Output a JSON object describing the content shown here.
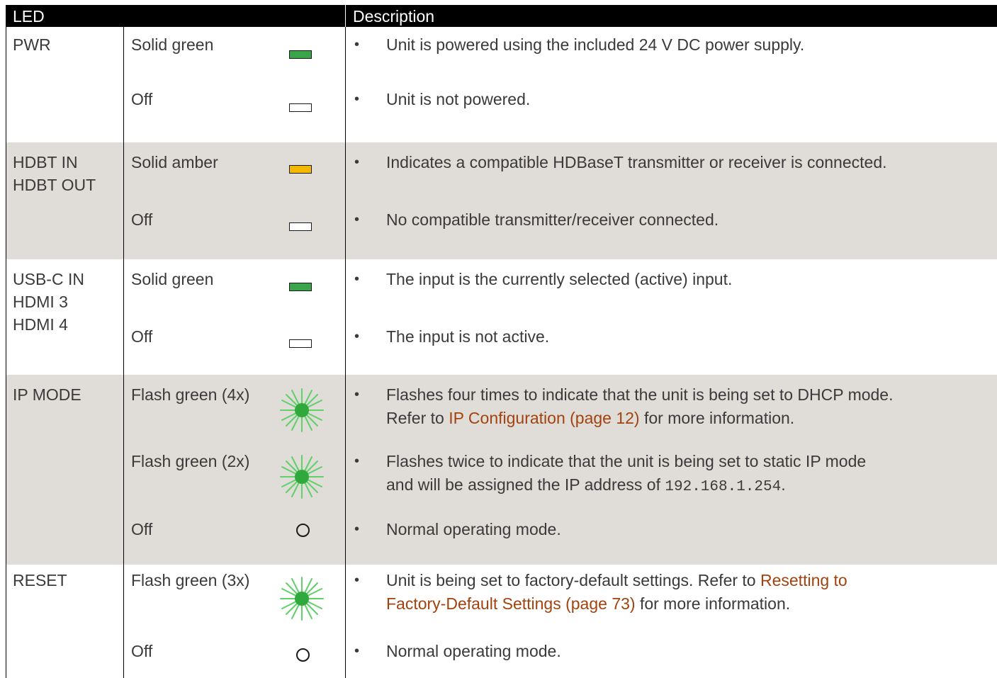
{
  "header": {
    "led": "LED",
    "description": "Description"
  },
  "colors": {
    "green": "#3aa54a",
    "amber": "#f5b800",
    "link": "#a2430f",
    "shade": "#e0dcd8"
  },
  "groups": [
    {
      "leds": [
        "PWR"
      ],
      "rows": [
        {
          "state": "Solid green",
          "icon": "led-solid-green-icon",
          "desc": [
            "Unit is powered using the included 24 V DC power supply."
          ]
        },
        {
          "state": "Off",
          "icon": "led-off-icon",
          "desc": [
            "Unit is not powered."
          ]
        }
      ]
    },
    {
      "leds": [
        "HDBT IN",
        "HDBT OUT"
      ],
      "rows": [
        {
          "state": "Solid amber",
          "icon": "led-solid-amber-icon",
          "desc": [
            "Indicates a compatible HDBaseT transmitter or receiver is connected."
          ]
        },
        {
          "state": "Off",
          "icon": "led-off-icon",
          "desc": [
            "No compatible transmitter/receiver connected."
          ]
        }
      ]
    },
    {
      "leds": [
        "USB-C IN",
        "HDMI 3",
        "HDMI 4"
      ],
      "rows": [
        {
          "state": "Solid green",
          "icon": "led-solid-green-icon",
          "desc": [
            "The input is the currently selected (active) input."
          ]
        },
        {
          "state": "Off",
          "icon": "led-off-icon",
          "desc": [
            "The input is not active."
          ]
        }
      ]
    },
    {
      "leds": [
        "IP MODE"
      ],
      "rows": [
        {
          "state": "Flash green (4x)",
          "icon": "led-flash-green-icon",
          "desc": [
            "Flashes four times to indicate that the unit is being set to DHCP mode.",
            "Refer to ",
            "IP Configuration (page 12)",
            " for more information."
          ]
        },
        {
          "state": "Flash green (2x)",
          "icon": "led-flash-green-icon",
          "desc": [
            "Flashes twice to indicate that the unit is being set to static IP mode",
            "and will be assigned the IP address of ",
            "192.168.1.254",
            "."
          ]
        },
        {
          "state": "Off",
          "icon": "led-off-circle-icon",
          "desc": [
            "Normal operating mode."
          ]
        }
      ]
    },
    {
      "leds": [
        "RESET"
      ],
      "rows": [
        {
          "state": "Flash green (3x)",
          "icon": "led-flash-green-icon",
          "desc": [
            "Unit is being set to factory-default settings.  Refer to ",
            "Resetting to",
            "Factory-Default Settings (page 73)",
            " for more information."
          ]
        },
        {
          "state": "Off",
          "icon": "led-off-circle-icon",
          "desc": [
            "Normal operating mode."
          ]
        }
      ]
    }
  ]
}
